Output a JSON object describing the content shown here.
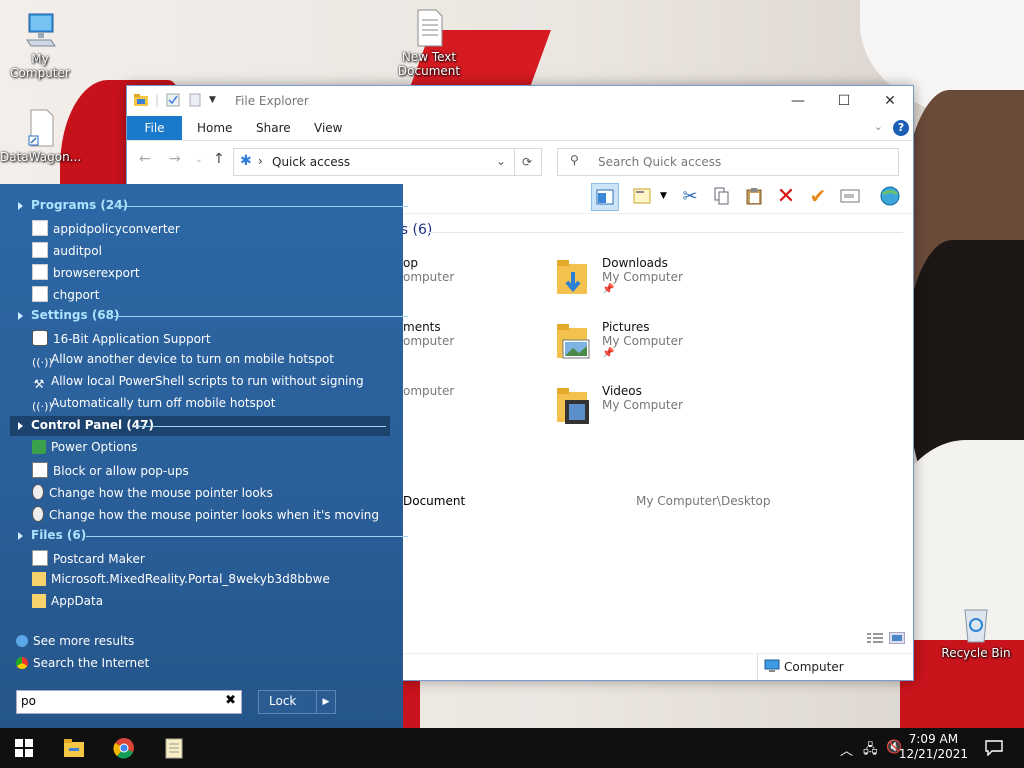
{
  "desktop": {
    "icons": [
      {
        "label": "My Computer"
      },
      {
        "label": "New Text Document"
      },
      {
        "label": "DataWagon..."
      },
      {
        "label": "Recycle Bin"
      }
    ]
  },
  "explorer": {
    "title": "File Explorer",
    "ribbon_tabs": [
      "File",
      "Home",
      "Share",
      "View"
    ],
    "address": "Quick access",
    "search_placeholder": "Search Quick access",
    "section_header": "rs (6)",
    "items": [
      {
        "name": "op",
        "location": "omputer"
      },
      {
        "name": "Downloads",
        "location": "My Computer"
      },
      {
        "name": "ments",
        "location": "omputer"
      },
      {
        "name": "Pictures",
        "location": "My Computer"
      },
      {
        "name": "",
        "location": "omputer"
      },
      {
        "name": "Videos",
        "location": "My Computer"
      }
    ],
    "recent_file": {
      "name": "Document",
      "path": "My Computer\\Desktop"
    },
    "status_location": "Computer"
  },
  "search_panel": {
    "groups": [
      {
        "label": "Programs (24)",
        "items": [
          "appidpolicyconverter",
          "auditpol",
          "browserexport",
          "chgport"
        ]
      },
      {
        "label": "Settings (68)",
        "items": [
          "16-Bit Application Support",
          "Allow another device to turn on mobile hotspot",
          "Allow local PowerShell scripts to run without signing",
          "Automatically turn off mobile hotspot"
        ]
      },
      {
        "label": "Control Panel (47)",
        "items": [
          "Power Options",
          "Block or allow pop-ups",
          "Change how the mouse pointer looks",
          "Change how the mouse pointer looks when it's moving"
        ]
      },
      {
        "label": "Files (6)",
        "items": [
          "Postcard Maker",
          "Microsoft.MixedReality.Portal_8wekyb3d8bbwe",
          "AppData"
        ]
      }
    ],
    "see_more": "See more results",
    "search_internet": "Search the Internet",
    "query": "po",
    "lock_label": "Lock"
  },
  "taskbar": {
    "time": "7:09 AM",
    "date": "12/21/2021"
  },
  "colors": {
    "panel_bg": "#2b5d93",
    "group_header": "#aee3ff",
    "accent": "#1979ca"
  }
}
